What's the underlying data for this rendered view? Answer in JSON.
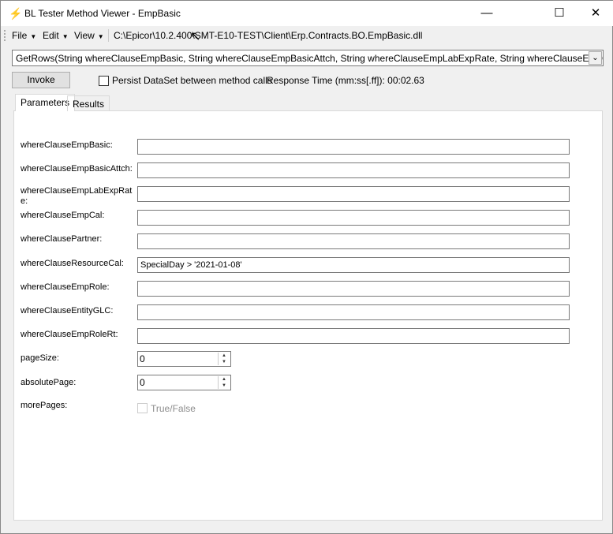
{
  "window": {
    "title": "BL Tester Method Viewer - EmpBasic"
  },
  "menu": {
    "file": "File",
    "edit": "Edit",
    "view": "View",
    "path": "C:\\Epicor\\10.2.400\\SMT-E10-TEST\\Client\\Erp.Contracts.BO.EmpBasic.dll"
  },
  "method_select": {
    "value": "GetRows(String whereClauseEmpBasic, String whereClauseEmpBasicAttch, String whereClauseEmpLabExpRate, String whereClauseEmpCal, S"
  },
  "toolbar": {
    "invoke": "Invoke",
    "persist": "Persist DataSet between method calls",
    "response_time": "Response Time (mm:ss[.ff]): 00:02.63"
  },
  "tabs": [
    "Parameters",
    "Results"
  ],
  "params": [
    {
      "label": "whereClauseEmpBasic:",
      "value": ""
    },
    {
      "label": "whereClauseEmpBasicAttch:",
      "value": ""
    },
    {
      "label": "whereClauseEmpLabExpRate:",
      "value": ""
    },
    {
      "label": "whereClauseEmpCal:",
      "value": ""
    },
    {
      "label": "whereClausePartner:",
      "value": ""
    },
    {
      "label": "whereClauseResourceCal:",
      "value": "SpecialDay >  '2021-01-08'"
    },
    {
      "label": "whereClauseEmpRole:",
      "value": ""
    },
    {
      "label": "whereClauseEntityGLC:",
      "value": ""
    },
    {
      "label": "whereClauseEmpRoleRt:",
      "value": ""
    }
  ],
  "pageSize": {
    "label": "pageSize:",
    "value": "0"
  },
  "absolutePage": {
    "label": "absolutePage:",
    "value": "0"
  },
  "morePages": {
    "label": "morePages:",
    "checkbox_label": "True/False"
  }
}
